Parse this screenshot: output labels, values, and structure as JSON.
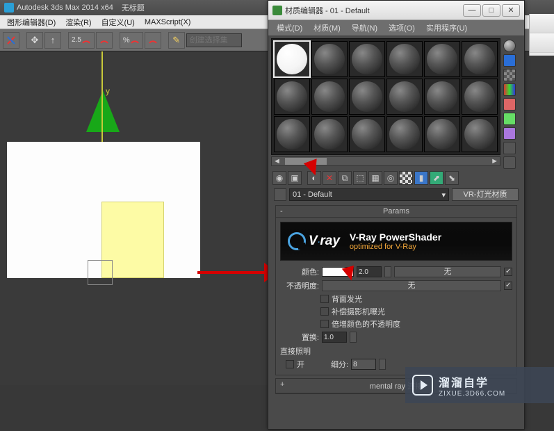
{
  "main": {
    "title": "Autodesk 3ds Max  2014 x64",
    "doc": "无标题",
    "menu": [
      "图形编辑器(D)",
      "渲染(R)",
      "自定义(U)",
      "MAXScript(X)"
    ],
    "create_set_placeholder": "创建选择集",
    "axis_y": "y",
    "angle_label": "2.5",
    "pct_label": "%"
  },
  "material_editor": {
    "title": "材质编辑器 - 01 - Default",
    "menu": [
      "模式(D)",
      "材质(M)",
      "导航(N)",
      "选项(O)",
      "实用程序(U)"
    ],
    "name": "01 - Default",
    "type_button": "VR-灯光材质",
    "rollouts": {
      "params": {
        "title": "Params",
        "vray_line1": "V-Ray PowerShader",
        "vray_line2": "optimized for V-Ray",
        "vray_logo": "V·ray",
        "color_label": "颜色:",
        "value": "2.0",
        "none_label": "无",
        "opacity_label": "不透明度:",
        "opacity_none": "无",
        "backlight": "背面发光",
        "compensate": "补偿摄影机曝光",
        "multiply": "倍增颜色的不透明度",
        "displace_label": "置换:",
        "displace_val": "1.0",
        "direct_label": "直接照明",
        "on_label": "开",
        "subdiv_label": "细分:",
        "subdiv_val": "8"
      },
      "mentalray": {
        "title": "mental ray 连接"
      }
    }
  },
  "watermark": {
    "big": "溜溜自学",
    "small": "ZIXUE.3D66.COM"
  },
  "icons": {
    "min": "—",
    "max": "□",
    "close": "✕",
    "dd": "▾",
    "left": "◄",
    "right": "►",
    "plus": "+",
    "minus": "-"
  }
}
